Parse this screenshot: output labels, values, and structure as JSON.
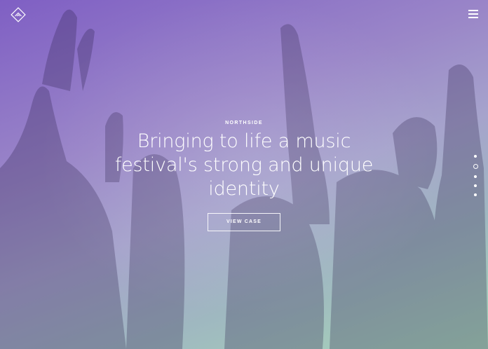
{
  "header": {
    "logo_icon": "diamond-logo-icon",
    "menu_icon": "hamburger-menu-icon"
  },
  "hero": {
    "eyebrow": "NORTHSIDE",
    "headline": "Bringing to life a music festival's strong and unique identity",
    "cta_label": "VIEW CASE"
  },
  "pagination": {
    "count": 5,
    "active_index": 1
  },
  "colors": {
    "gradient_start": "#7f5fc4",
    "gradient_mid": "#a6a3cc",
    "gradient_end": "#a7d6b8",
    "text": "#ffffff"
  }
}
